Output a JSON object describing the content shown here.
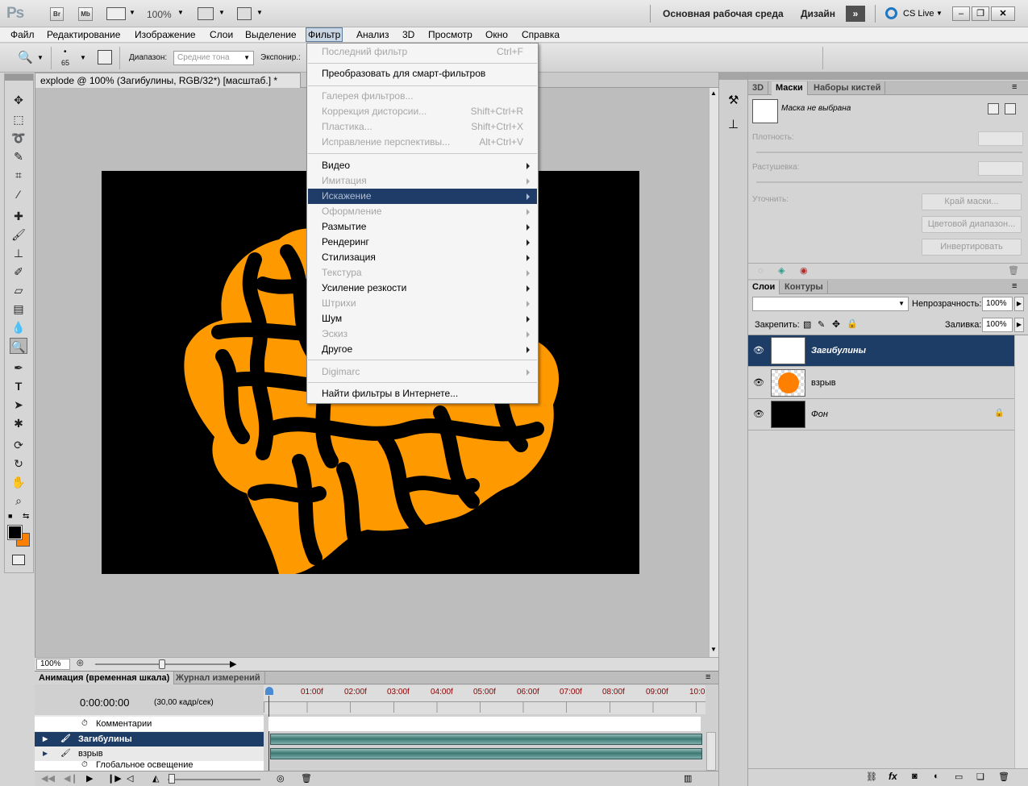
{
  "app": {
    "logo": "Ps",
    "bridge_label": "Br",
    "mini_bridge_label": "Mb",
    "zoom_value": "100%",
    "workspace": "Основная рабочая среда",
    "workspace_design": "Дизайн",
    "cs_live": "CS Live"
  },
  "menubar": [
    "Файл",
    "Редактирование",
    "Изображение",
    "Слои",
    "Выделение",
    "Фильтр",
    "Анализ",
    "3D",
    "Просмотр",
    "Окно",
    "Справка"
  ],
  "options": {
    "brush_size": "65",
    "range_label": "Диапазон:",
    "range_value": "Средние тона",
    "exposure_label": "Экспонир.:"
  },
  "document": {
    "tab_title": "explode @ 100% (Загибулины, RGB/32*) [масштаб.] *",
    "status_zoom": "100%"
  },
  "filter_menu": {
    "last_filter": "Последний фильтр",
    "last_filter_shortcut": "Ctrl+F",
    "smart": "Преобразовать для смарт-фильтров",
    "gallery": "Галерея фильтров...",
    "lens": "Коррекция дисторсии...",
    "lens_shortcut": "Shift+Ctrl+R",
    "liquify": "Пластика...",
    "liquify_shortcut": "Shift+Ctrl+X",
    "vanish": "Исправление перспективы...",
    "vanish_shortcut": "Alt+Ctrl+V",
    "video": "Видео",
    "artistic": "Имитация",
    "distort": "Искажение",
    "brush": "Оформление",
    "blur": "Размытие",
    "render": "Рендеринг",
    "stylize": "Стилизация",
    "texture": "Текстура",
    "sharpen": "Усиление резкости",
    "strokes": "Штрихи",
    "noise": "Шум",
    "sketch": "Эскиз",
    "other": "Другое",
    "digimarc": "Digimarc",
    "online": "Найти фильтры в Интернете..."
  },
  "masks_panel": {
    "tabs": [
      "3D",
      "Маски",
      "Наборы кистей"
    ],
    "no_mask": "Маска не выбрана",
    "density_label": "Плотность:",
    "feather_label": "Растушевка:",
    "refine_label": "Уточнить:",
    "mask_edge": "Край маски...",
    "color_range": "Цветовой диапазон...",
    "invert": "Инвертировать"
  },
  "layers_panel": {
    "tabs": [
      "Слои",
      "Контуры"
    ],
    "opacity_label": "Непрозрачность:",
    "opacity_value": "100%",
    "lock_label": "Закрепить:",
    "fill_label": "Заливка:",
    "fill_value": "100%",
    "layers": [
      {
        "name": "Загибулины",
        "selected": true
      },
      {
        "name": "взрыв",
        "selected": false
      },
      {
        "name": "Фон",
        "selected": false
      }
    ]
  },
  "timeline": {
    "tabs": [
      "Анимация (временная шкала)",
      "Журнал измерений"
    ],
    "time": "0:00:00:00",
    "fps": "(30,00 кадр/сек)",
    "ruler": [
      "01:00f",
      "02:00f",
      "03:00f",
      "04:00f",
      "05:00f",
      "06:00f",
      "07:00f",
      "08:00f",
      "09:00f",
      "10:0"
    ],
    "rows": [
      "Комментарии",
      "Загибулины",
      "взрыв",
      "Глобальное освещение"
    ]
  },
  "colors": {
    "accent": "#1e3d66",
    "orange": "#ff9900",
    "canvas_bg": "#000000"
  }
}
